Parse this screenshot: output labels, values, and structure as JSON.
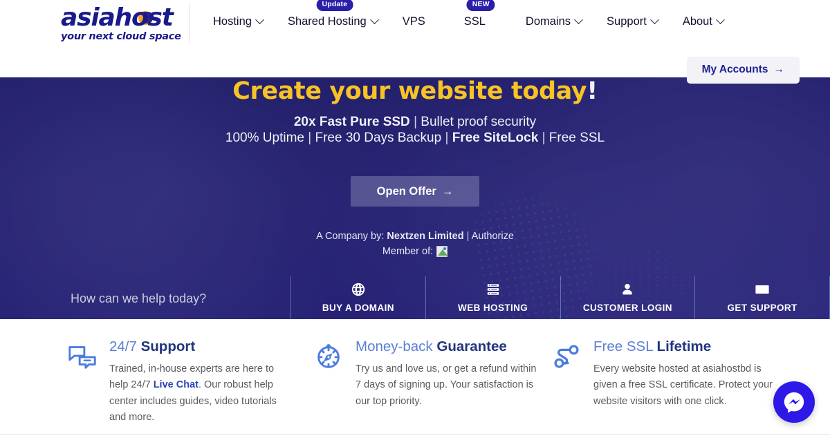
{
  "brand": {
    "logo_text": "asiahost",
    "logo_tagline": "your next cloud space"
  },
  "nav": {
    "items": [
      {
        "label": "Hosting",
        "has_dropdown": true,
        "badge": ""
      },
      {
        "label": "Shared Hosting",
        "has_dropdown": true,
        "badge": "Update"
      },
      {
        "label": "VPS",
        "has_dropdown": false,
        "badge": ""
      },
      {
        "label": "SSL",
        "has_dropdown": false,
        "badge": "NEW"
      },
      {
        "label": "Domains",
        "has_dropdown": true,
        "badge": ""
      },
      {
        "label": "Support",
        "has_dropdown": true,
        "badge": ""
      },
      {
        "label": "About",
        "has_dropdown": true,
        "badge": ""
      }
    ],
    "my_accounts_label": "My Accounts",
    "my_accounts_arrow": "→"
  },
  "hero": {
    "title_main": "Create your website today",
    "title_bang": "!",
    "sub_line1_bold": "20x Fast Pure SSD",
    "sub_line1_rest": "Bullet proof security",
    "sub_line2_a": "100% Uptime",
    "sub_line2_b": "Free 30 Days Backup",
    "sub_line2_c": "Free SiteLock",
    "sub_line2_d": "Free SSL",
    "separator": "|",
    "cta_label": "Open Offer",
    "cta_arrow": "→",
    "company_prefix": "A Company by:",
    "company_name": "Nextzen Limited",
    "company_suffix": "Authorize",
    "member_label": "Member of:",
    "member_image_alt": "broken-image"
  },
  "quick_links": {
    "help_text": "How can we help today?",
    "items": [
      {
        "label": "BUY A DOMAIN",
        "icon": "globe-icon"
      },
      {
        "label": "WEB HOSTING",
        "icon": "server-icon"
      },
      {
        "label": "CUSTOMER LOGIN",
        "icon": "user-icon"
      },
      {
        "label": "GET SUPPORT",
        "icon": "envelope-icon"
      }
    ]
  },
  "features": [
    {
      "icon": "chat-bubbles-icon",
      "title_light": "24/7",
      "title_bold": "Support",
      "text_1": "Trained, in-house experts are here to help 24/7",
      "link": "Live Chat",
      "text_2": ". Our robust help center includes guides, video tutorials and more."
    },
    {
      "icon": "compass-icon",
      "title_light": "Money-back",
      "title_bold": "Guarantee",
      "text_1": "Try us and love us, or get a refund within 7 days of signing up. Your satisfaction is our top priority.",
      "link": "",
      "text_2": ""
    },
    {
      "icon": "ssl-network-icon",
      "title_light": "Free SSL",
      "title_bold": "Lifetime",
      "text_1": "Every website hosted at asiahostbd is given a free SSL certificate. Protect your website visitors with one click.",
      "link": "",
      "text_2": ""
    }
  ],
  "chat_widget": {
    "icon": "messenger-icon"
  },
  "colors": {
    "brand_navy": "#1a1a8c",
    "brand_gold": "#f5a81c",
    "hero_bg": "#231f6e",
    "hero_title": "#f7c325",
    "badge_bg": "#2a1fa8",
    "feature_title_light": "#5b7fd4",
    "feature_title_bold": "#21357e",
    "messenger_blue": "#2d18e8"
  }
}
